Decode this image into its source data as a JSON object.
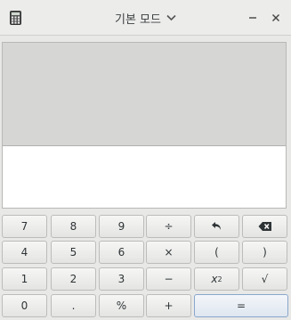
{
  "window": {
    "title": "기본 모드",
    "icons": {
      "app": "calculator-icon",
      "mode": "chevron-down-icon",
      "minimize": "minimize-icon",
      "close": "close-icon"
    }
  },
  "display": {
    "history": [],
    "entry": ""
  },
  "keypad": {
    "row1": {
      "k7": "7",
      "k8": "8",
      "k9": "9",
      "div": "÷",
      "undo": "undo-icon",
      "backspace": "backspace-icon"
    },
    "row2": {
      "k4": "4",
      "k5": "5",
      "k6": "6",
      "mul": "×",
      "lparen": "(",
      "rparen": ")"
    },
    "row3": {
      "k1": "1",
      "k2": "2",
      "k3": "3",
      "minus": "−",
      "sq_base": "x",
      "sq_exp": "2",
      "sqrt": "√"
    },
    "row4": {
      "k0": "0",
      "dot": ".",
      "pct": "%",
      "plus": "+",
      "eq": "="
    }
  }
}
